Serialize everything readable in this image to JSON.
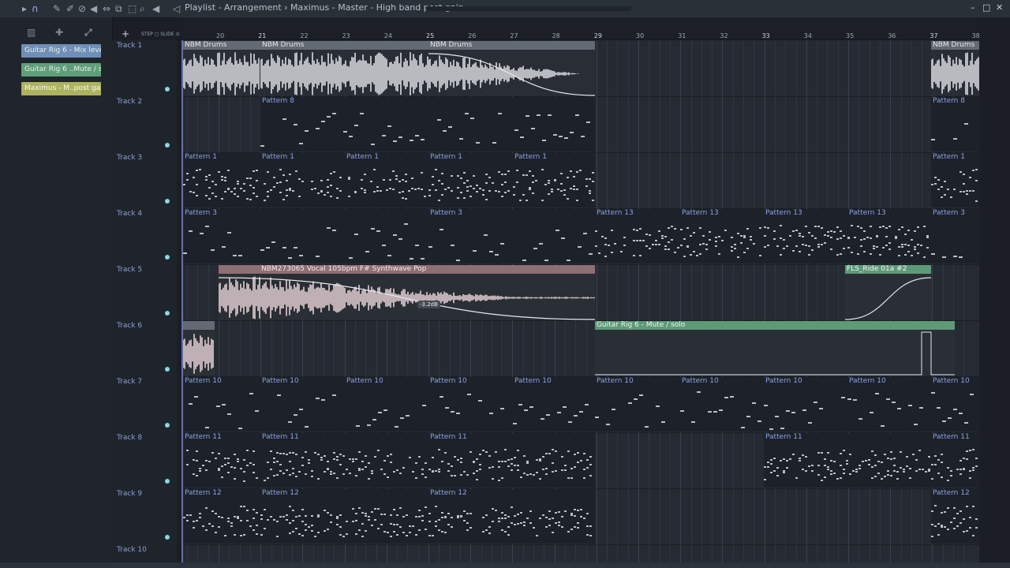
{
  "titlebar": {
    "breadcrumb": "Playlist - Arrangement › Maximus - Master - High band post gain ›",
    "controls": [
      "–",
      "□",
      "✕"
    ]
  },
  "left_panel": {
    "clips": [
      {
        "label": "Guitar Rig 6 - Mix level",
        "color": "#6f8fb8"
      },
      {
        "label": "Guitar Rig 6 ..Mute / solo",
        "color": "#5f9e7a"
      },
      {
        "label": "Maximus - M..post gain",
        "color": "#aeb35f"
      }
    ]
  },
  "ruler": {
    "bars": [
      "20",
      "21",
      "22",
      "23",
      "24",
      "25",
      "26",
      "27",
      "28",
      "29",
      "30",
      "31",
      "32",
      "33",
      "34",
      "35",
      "36",
      "37",
      "38"
    ]
  },
  "tracks": [
    {
      "name": "Track 1"
    },
    {
      "name": "Track 2"
    },
    {
      "name": "Track 3"
    },
    {
      "name": "Track 4"
    },
    {
      "name": "Track 5"
    },
    {
      "name": "Track 6"
    },
    {
      "name": "Track 7"
    },
    {
      "name": "Track 8"
    },
    {
      "name": "Track 9"
    },
    {
      "name": "Track 10"
    }
  ],
  "playlist": {
    "track1": {
      "clips": [
        "NBM Drums",
        "NBM Drums",
        "NBM Drums",
        "NBM Drums"
      ]
    },
    "track2": {
      "clips": [
        "Pattern 8",
        "Pattern 8"
      ]
    },
    "track3": {
      "clips": [
        "Pattern 1",
        "Pattern 1",
        "Pattern 1",
        "Pattern 1",
        "Pattern 1",
        "Pattern 1"
      ]
    },
    "track4": {
      "clips": [
        "Pattern 3",
        "Pattern 3",
        "Pattern 13",
        "Pattern 13",
        "Pattern 13",
        "Pattern 13",
        "Pattern 3"
      ]
    },
    "track5": {
      "clips": [
        "NBM273065 Vocal 105bpm F# Synthwave Pop",
        "FLS_Ride 01a #2"
      ],
      "gain_badge": "-3.2dB"
    },
    "track6": {
      "clips": [
        "Guitar Rig 6 - Mute / solo"
      ]
    },
    "track7": {
      "clips": [
        "Pattern 10",
        "Pattern 10",
        "Pattern 10",
        "Pattern 10",
        "Pattern 10",
        "Pattern 10",
        "Pattern 10",
        "Pattern 10",
        "Pattern 10",
        "Pattern 10"
      ]
    },
    "track8": {
      "clips": [
        "Pattern 11",
        "Pattern 11",
        "Pattern 11",
        "Pattern 11",
        "Pattern 11"
      ]
    },
    "track9": {
      "clips": [
        "Pattern 12",
        "Pattern 12",
        "Pattern 12",
        "Pattern 12"
      ]
    }
  },
  "colors": {
    "pattern_label": "#8ca3e6",
    "audio_header": "#646a73",
    "vocal_header": "#8e6f72",
    "automation_header": "#5e9a78"
  }
}
